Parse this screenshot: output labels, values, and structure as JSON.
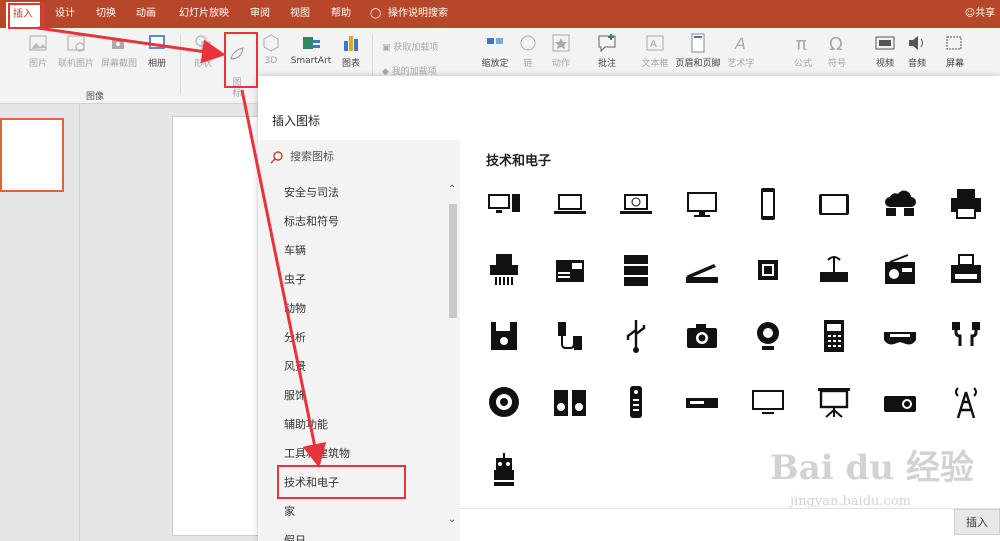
{
  "tabs": [
    "插入",
    "设计",
    "切换",
    "动画",
    "幻灯片放映",
    "审阅",
    "视图",
    "帮助",
    "操作说明搜索"
  ],
  "share": "共享",
  "ribbon": {
    "picture": "图片",
    "online_picture": "联机图片",
    "screenshot": "屏幕截图",
    "album": "相册",
    "images_group": "图像",
    "shapes": "形状",
    "icons": "图\n标",
    "model3d": "3D",
    "smartart": "SmartArt",
    "chart": "图表",
    "get_addins": "获取加载项",
    "my_addins": "我的加载项",
    "zoom": "缩放定",
    "link": "链",
    "action": "动作",
    "comment": "批注",
    "textbox": "文本框",
    "header_footer": "页眉和页脚",
    "wordart": "艺术字",
    "equation": "公式",
    "symbol": "符号",
    "video": "视频",
    "audio": "音频",
    "screen_rec": "屏幕"
  },
  "dialog": {
    "title": "插入图标",
    "search_placeholder": "搜索图标",
    "categories": [
      "安全与司法",
      "标志和符号",
      "车辆",
      "虫子",
      "动物",
      "分析",
      "风景",
      "服饰",
      "辅助功能",
      "工具和建筑物",
      "技术和电子",
      "家",
      "假日"
    ],
    "selected": "技术和电子",
    "section_title": "技术和电子",
    "icons": [
      "desktop-computer",
      "laptop",
      "laptop-globe",
      "monitor",
      "smartphone",
      "tablet",
      "cloud-sync",
      "printer",
      "shredder",
      "fax-machine",
      "server",
      "scanner",
      "microchip",
      "router",
      "radio",
      "typewriter",
      "floppy-disk",
      "usb-cable",
      "usb-symbol",
      "camera",
      "webcam",
      "calculator",
      "vr-headset",
      "earphones",
      "speaker",
      "stereo-speakers",
      "remote-control",
      "dvd-player",
      "television",
      "projector-screen",
      "projector",
      "cell-tower",
      "robot"
    ],
    "insert_button": "插入"
  },
  "watermark": {
    "brand": "Bai du 经验",
    "url": "jingyan.baidu.com"
  }
}
